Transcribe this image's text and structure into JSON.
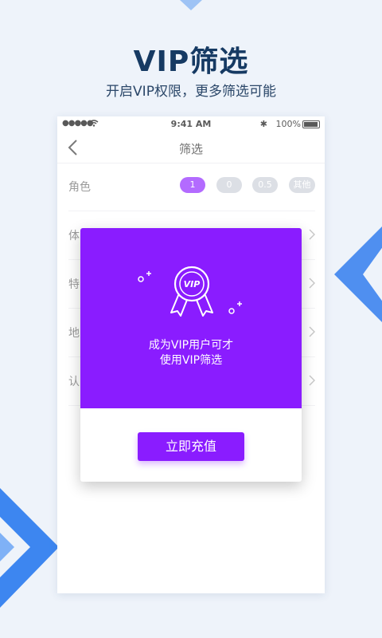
{
  "hero": {
    "title": "VIP筛选",
    "subtitle": "开启VIP权限，更多筛选可能"
  },
  "status_bar": {
    "signal": "●●●●●",
    "time": "9:41 AM",
    "bluetooth": "✱",
    "battery": "100%"
  },
  "nav": {
    "title": "筛选",
    "back_icon": "chevron-left-icon"
  },
  "filters": {
    "role": {
      "label": "角色",
      "options": [
        "1",
        "0",
        "0.5",
        "其他"
      ],
      "selected": "1"
    },
    "row2": {
      "label": "体",
      "value": ""
    },
    "row3": {
      "label": "特",
      "value": ""
    },
    "row4": {
      "label": "地",
      "value": ""
    },
    "row5": {
      "label": "认",
      "value": ""
    }
  },
  "modal": {
    "icon": "award-ribbon-icon",
    "badge_text": "VIP",
    "line1": "成为VIP用户可才",
    "line2": "使用VIP筛选",
    "button": "立即充值"
  },
  "colors": {
    "accent": "#8a1cff",
    "background": "#eef3fa",
    "title": "#163a63",
    "pill_inactive": "#c9ced8"
  }
}
